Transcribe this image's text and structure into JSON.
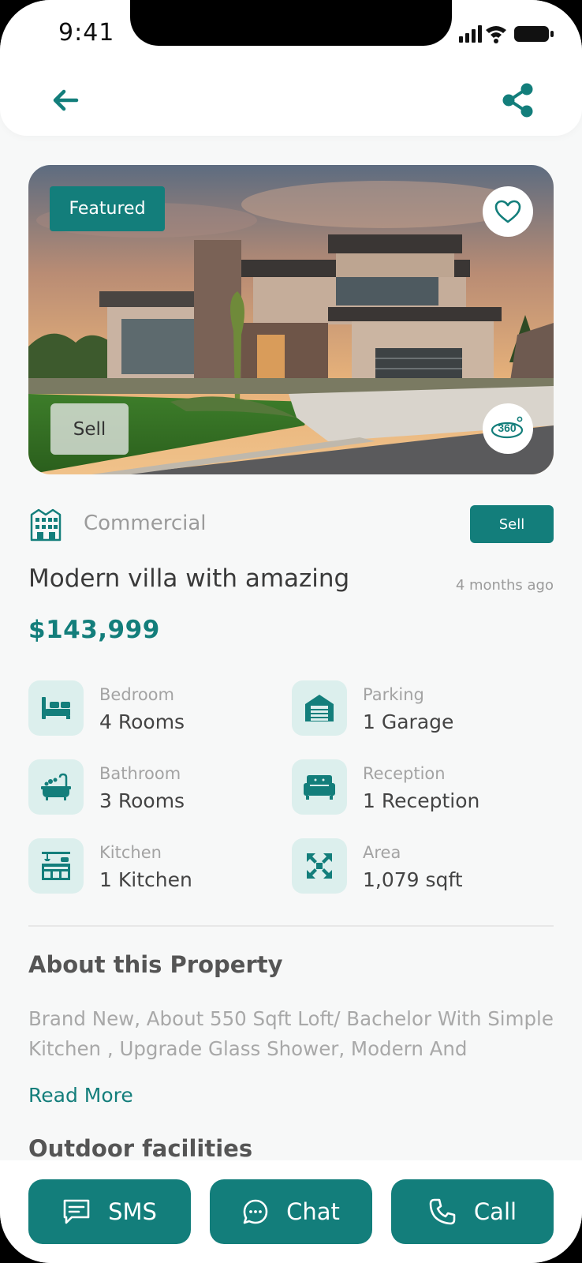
{
  "status_bar": {
    "time": "9:41"
  },
  "hero": {
    "featured_label": "Featured",
    "sell_label": "Sell"
  },
  "property": {
    "type": "Commercial",
    "badge": "Sell",
    "title": "Modern villa with amazing",
    "posted": "4 months ago",
    "price": "$143,999"
  },
  "features": [
    {
      "label": "Bedroom",
      "value": "4 Rooms",
      "icon": "bed-icon"
    },
    {
      "label": "Parking",
      "value": "1 Garage",
      "icon": "garage-icon"
    },
    {
      "label": "Bathroom",
      "value": "3 Rooms",
      "icon": "bathtub-icon"
    },
    {
      "label": "Reception",
      "value": "1 Reception",
      "icon": "sofa-icon"
    },
    {
      "label": "Kitchen",
      "value": "1 Kitchen",
      "icon": "kitchen-icon"
    },
    {
      "label": "Area",
      "value": "1,079 sqft",
      "icon": "expand-icon"
    }
  ],
  "about": {
    "heading": "About this Property",
    "text": "Brand New, About 550 Sqft Loft/ Bachelor With Simple Kitchen , Upgrade Glass Shower, Modern And",
    "read_more": "Read More"
  },
  "outdoor": {
    "heading": "Outdoor facilities"
  },
  "actions": {
    "sms": "SMS",
    "chat": "Chat",
    "call": "Call"
  },
  "colors": {
    "accent": "#137e7b",
    "icon_bg": "#dcefed"
  }
}
